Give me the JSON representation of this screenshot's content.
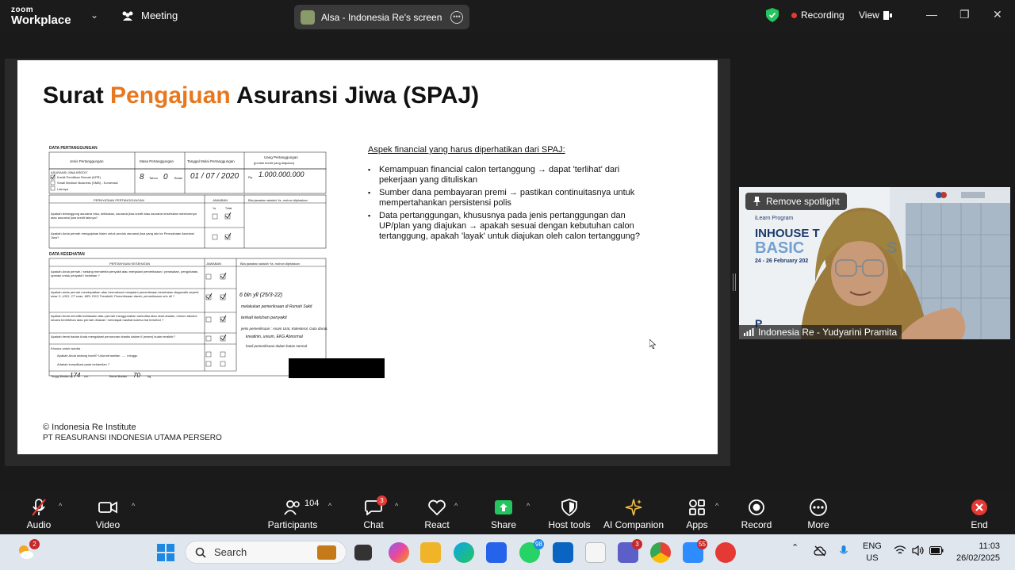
{
  "topbar": {
    "logo_line1": "zoom",
    "logo_line2": "Workplace",
    "meeting_label": "Meeting",
    "share_title": "Alsa - Indonesia Re's screen",
    "recording_label": "Recording",
    "view_label": "View"
  },
  "slide": {
    "title_part1": "Surat ",
    "title_part2": "Pengajuan",
    "title_part3": " Asuransi Jiwa (SPAJ)",
    "aspek_heading": "Aspek financial yang harus diperhatikan dari SPAJ:",
    "bullets": [
      "Kemampuan financial calon tertanggung → dapat 'terlihat' dari pekerjaan yang dituliskan",
      "Sumber dana pembayaran premi → pastikan continuitasnya untuk mempertahankan persistensi polis",
      "Data pertanggungan, khususnya pada jenis pertanggungan dan UP/plan yang diajukan → apakah sesuai dengan kebutuhan calon tertanggung, apakah 'layak' untuk diajukan oleh calon tertanggung?"
    ],
    "footer_line1": "© Indonesia Re Institute",
    "footer_line2": "PT REASURANSI INDONESIA UTAMA PERSERO",
    "form": {
      "section1": "DATA PERTANGGUNGAN",
      "col_jenis": "Jenis Pertanggungan",
      "col_masa": "Masa Pertanggungan",
      "col_tanggal": "Tanggal Mulai Pertanggungan",
      "col_uang": "Uang Pertanggungan",
      "col_uang_sub": "(jumlah kredit yang diajukan)",
      "jenis_1": "ASURANSI JIWA KREDIT",
      "jenis_2": "Kredit Pemilikan Rumah (KPR)",
      "jenis_3": "Small Medium Business (SMB) - Komersial",
      "jenis_4": "Lainnya",
      "masa_value": "8",
      "masa_tahun": "Tahun",
      "masa_bulan_val": "0",
      "masa_bulan": "Bulan",
      "tanggal_value": "01 / 07 / 2020",
      "uang_prefix": "Rp.",
      "uang_value": "1.000.000.000",
      "pernyataan_header": "PERNYATAAN PERTANGGUNGAN",
      "jawaban_header": "JAWABAN",
      "jawaban_note": "Bila jawaban adalah Ya, mohon dijelaskan",
      "ya": "Ya",
      "tidak": "Tidak",
      "q1": "Apakah tertanggung asuransi bisa, ketidakan, asuransi jiwa kredit atau asuransi kesehatan sebelumnya atau asuransi jiwa kredit lainnya?",
      "q2": "Apakah Anda pernah mengajukan klaim untuk produk asuransi jiwa yang lain ke Perusahaan Asuransi Jiwa?",
      "section2": "DATA KESEHATAN",
      "kes_header": "PERTANYAAN KESEHATAN",
      "h1": "Apakah Anda pernah / sedang menderita penyakit atau menjalani pemeriksaan / perawatan, pengobatan, operasi untuk penyakit / kelainan ?",
      "h2": "Apakah anda pernah mendapatkan atau bermaksud menjalani pemeriksaan kesehatan diagnostik seperti sinar X, USG, CT scan, MRI, EKG Treadmill, Pemeriksaan darah, pemeriksaan urin dll ?",
      "h3": "Apakah Anda memiliki kebiasaan atau pernah menggunakan narkotika atau obat-obatan, minum alkohol secara berlebihan atau pernah dirawat / mendapat nasihat karena hal tersebut ?",
      "h4": "Apakah berat badan Anda mengalami penurunan drastis dalam 6 (enam) bulan terakhir?",
      "h5": "Khusus untuk wanita :",
      "h5a": "Apakah Anda sedang hamil? Usia kehamilan ...... minggu",
      "h5b": "Adakah komplikasi pada kehamilan ?",
      "h6_tinggi": "Tinggi Badan",
      "h6_tinggi_val": "174",
      "h6_cm": "cm",
      "h6_berat": "Berat Badan",
      "h6_berat_val": "70",
      "h6_kg": "kg",
      "note1": "6 bln yll (25/3-22)",
      "note2": "melakukan pemeriksaan di Rumah Sakit",
      "note3": "terkait keluhan penyakit",
      "note4": "jenis pemeriksaan : Asam Urat, Kolesterol, Gula darah,",
      "note5": "kreatinin, ureum, EKG Abnormal",
      "note6": "hasil pemeriksaan dalam batas normal"
    }
  },
  "video": {
    "spotlight_btn": "Remove spotlight",
    "participant_name": "Indonesia Re - Yudyarini Pramita",
    "banner_small": "iLearn Program",
    "banner_big1": "INHOUSE T",
    "banner_big2": "BASIC",
    "banner_big3": "S",
    "banner_date": "24 - 26 February 202",
    "banner_letter": "P"
  },
  "toolbar": {
    "audio": "Audio",
    "video": "Video",
    "participants": "Participants",
    "participants_count": "104",
    "chat": "Chat",
    "chat_badge": "3",
    "react": "React",
    "share": "Share",
    "host_tools": "Host tools",
    "ai_companion": "AI Companion",
    "apps": "Apps",
    "record": "Record",
    "more": "More",
    "end": "End"
  },
  "taskbar": {
    "weather_badge": "2",
    "search_placeholder": "Search",
    "whatsapp_badge": "98",
    "teams_badge": "3",
    "zoom_badge": "55",
    "lang_line1": "ENG",
    "lang_line2": "US",
    "time": "11:03",
    "date": "26/02/2025"
  },
  "colors": {
    "accent_orange": "#e8771e",
    "recording_red": "#e53935",
    "share_green": "#22c55e",
    "end_red": "#e53935"
  }
}
